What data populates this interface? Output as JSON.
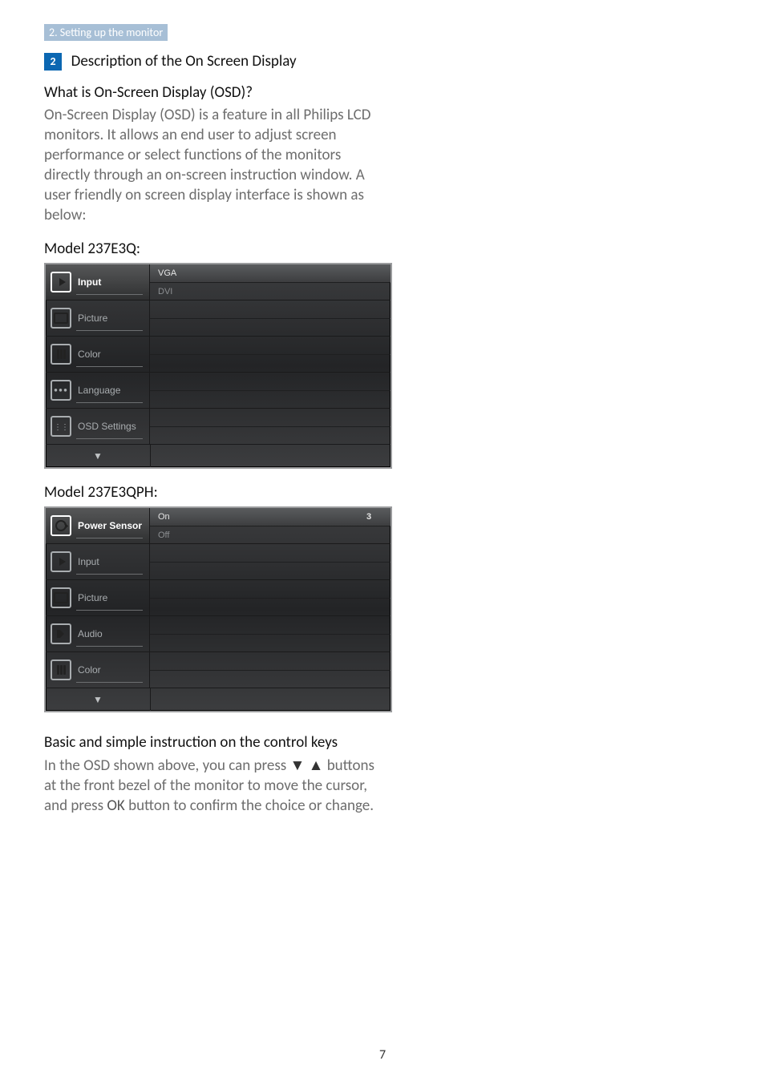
{
  "breadcrumb": "2. Setting up the monitor",
  "badge_num": "2",
  "section_title": "Description of the On Screen Display",
  "q_heading": "What is On-Screen Display (OSD)?",
  "q_body": "On-Screen Display (OSD) is a feature in all Philips LCD monitors. It allows an end user to adjust screen performance or select functions of the monitors directly through an on-screen instruction window. A user friendly on screen display interface is shown as below:",
  "model1_heading": "Model 237E3Q:",
  "model2_heading": "Model 237E3QPH:",
  "basic_heading": "Basic and simple instruction on the control keys",
  "basic_body_1": "In the OSD shown above, you can press ",
  "basic_body_down": "▼",
  "basic_body_up": "▲",
  "basic_body_2": " buttons at the front bezel of the monitor to move the cursor, and press ",
  "basic_body_ok": "OK",
  "basic_body_3": " button to confirm the choice or change.",
  "osd_arrow_down": "▼",
  "osd1": {
    "rows": [
      {
        "label": "Input",
        "selected": true,
        "icon": "input",
        "sub": [
          {
            "k": "VGA",
            "sel": true
          },
          {
            "k": "DVI",
            "dot": true
          }
        ]
      },
      {
        "label": "Picture",
        "icon": "picture",
        "sub": [
          {
            "dot": true
          },
          {
            "dot": true
          }
        ]
      },
      {
        "label": "Color",
        "icon": "color",
        "sub": [
          {
            "dot": true
          },
          {
            "dot": true
          }
        ]
      },
      {
        "label": "Language",
        "icon": "lang",
        "sub": [
          {
            "dot": true
          },
          {
            "dot": true
          }
        ]
      },
      {
        "label": "OSD Settings",
        "icon": "osd",
        "sub": [
          {
            "dot": true
          },
          {
            "dot": true
          }
        ]
      }
    ]
  },
  "osd2": {
    "rows": [
      {
        "label": "Power Sensor",
        "selected": true,
        "icon": "sensor",
        "sub": [
          {
            "k": "On",
            "sel": true,
            "v": "3"
          },
          {
            "k": "Off",
            "dot": true
          }
        ]
      },
      {
        "label": "Input",
        "icon": "input",
        "sub": [
          {
            "dot": true
          },
          {
            "dot": true
          }
        ]
      },
      {
        "label": "Picture",
        "icon": "picture",
        "sub": [
          {
            "dot": true
          },
          {
            "dot": true
          }
        ]
      },
      {
        "label": "Audio",
        "icon": "audio",
        "sub": [
          {
            "dot": true
          },
          {
            "dot": true
          }
        ]
      },
      {
        "label": "Color",
        "icon": "color",
        "sub": [
          {
            "dot": true
          },
          {
            "dot": true
          }
        ]
      }
    ]
  },
  "page_number": "7"
}
